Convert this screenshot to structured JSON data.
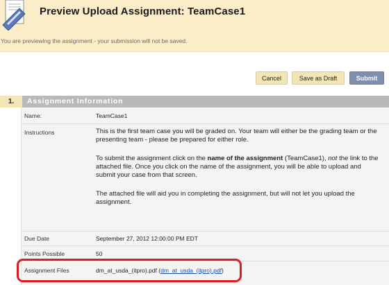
{
  "header": {
    "title": "Preview Upload Assignment: TeamCase1",
    "preview_message": "You are previewing the assignment - your submission will not be saved.",
    "icon": "assignment-document-icon"
  },
  "actions": {
    "cancel_label": "Cancel",
    "save_draft_label": "Save as Draft",
    "submit_label": "Submit"
  },
  "section": {
    "number": "1.",
    "title": "Assignment Information"
  },
  "fields": {
    "name_label": "Name:",
    "name_value": "TeamCase1",
    "instructions_label": "Instructions",
    "instr_p1": "This is the first team case you will be graded on. Your team will either be the grading team or the presenting team - please be prepared for either role.",
    "instr_p2_a": "To submit the assignment click on the ",
    "instr_p2_bold": "name of the assignment",
    "instr_p2_b": " (TeamCase1), ",
    "instr_p2_italic": "not",
    "instr_p2_c": " the link to the attached file. Once you click on the name of the assignment,  you will be able to upload and submit your case from that screen.",
    "instr_p3": "The attached file will aid you in completing the assignment, but will not let you upload the assignment.",
    "due_label": "Due Date",
    "due_value": "September 27, 2012 12:00:00 PM EDT",
    "points_label": "Points Possible",
    "points_value": "50",
    "files_label": "Assignment Files",
    "file_name": "dm_at_usda_(itpro).pdf",
    "file_link_open": "(",
    "file_link": "dm_at_usda_(itpro).pdf",
    "file_link_close": ")"
  },
  "colors": {
    "header_bg": "#fbedc7",
    "submit_bg": "#7f8ead",
    "section_bar": "#b9b9b9",
    "highlight": "#dd1d22"
  }
}
